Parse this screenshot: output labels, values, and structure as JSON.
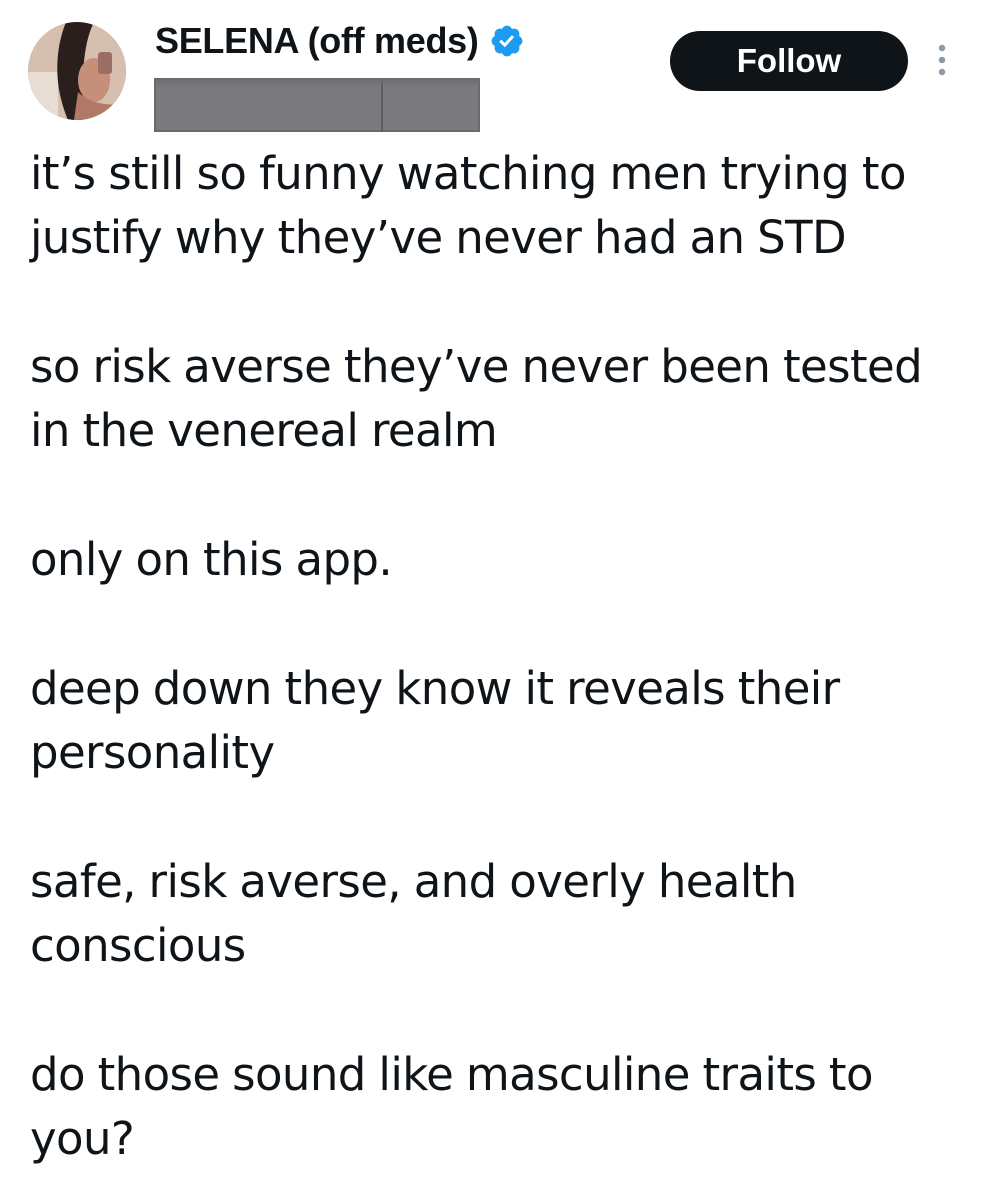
{
  "tweet": {
    "author": {
      "display_name": "SELENA (off meds)",
      "verified_icon": "verified-badge-icon",
      "avatar_icon": "avatar"
    },
    "follow_label": "Follow",
    "more_icon": "more-options-icon",
    "paragraphs": [
      [
        "it’s still so funny watching men trying to",
        "justify why they’ve never had an STD"
      ],
      [
        "so risk averse they’ve never been tested",
        "in the venereal realm"
      ],
      [
        "only on this app."
      ],
      [
        "deep down they know it reveals their",
        "personality"
      ],
      [
        "safe, risk averse, and overly health",
        "conscious"
      ],
      [
        "do those sound like masculine traits to",
        "you?"
      ]
    ]
  },
  "colors": {
    "text": "#0f1419",
    "follow_bg": "#0f1419",
    "follow_text": "#ffffff",
    "verified": "#1d9bf0",
    "redaction": "#7b7b7d"
  }
}
